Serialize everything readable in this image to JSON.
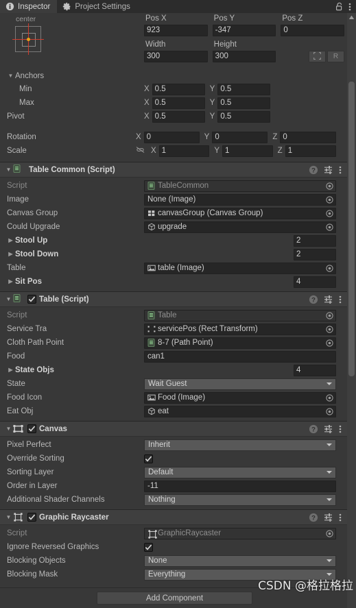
{
  "window": {
    "tabs": [
      {
        "label": "Inspector",
        "icon": "info-icon",
        "active": true
      },
      {
        "label": "Project Settings",
        "icon": "gear-icon",
        "active": false
      }
    ],
    "lock_icon": "lock-open-icon",
    "menu_icon": "kebab-menu-icon"
  },
  "rect_transform": {
    "anchor_preset": {
      "horizontal": "center",
      "vertical": "middle"
    },
    "fields": [
      {
        "label": "Pos X",
        "value": "923"
      },
      {
        "label": "Pos Y",
        "value": "-347"
      },
      {
        "label": "Pos Z",
        "value": "0"
      },
      {
        "label": "Width",
        "value": "300"
      },
      {
        "label": "Height",
        "value": "300"
      }
    ],
    "blueprint_button": "blueprint-mode-icon",
    "raw_button_label": "R",
    "anchors_label": "Anchors",
    "anchor_min": {
      "label": "Min",
      "x_label": "X",
      "x": "0.5",
      "y_label": "Y",
      "y": "0.5"
    },
    "anchor_max": {
      "label": "Max",
      "x_label": "X",
      "x": "0.5",
      "y_label": "Y",
      "y": "0.5"
    },
    "pivot": {
      "label": "Pivot",
      "x_label": "X",
      "x": "0.5",
      "y_label": "Y",
      "y": "0.5"
    },
    "rotation": {
      "label": "Rotation",
      "x_label": "X",
      "x": "0",
      "y_label": "Y",
      "y": "0",
      "z_label": "Z",
      "z": "0"
    },
    "scale": {
      "label": "Scale",
      "link_icon": "link-broken-icon",
      "x_label": "X",
      "x": "1",
      "y_label": "Y",
      "y": "1",
      "z_label": "Z",
      "z": "1"
    }
  },
  "components": [
    {
      "title": "Table Common (Script)",
      "icon": "cs-script-icon",
      "has_checkbox": false,
      "enabled": false,
      "rows": [
        {
          "kind": "object",
          "label": "Script",
          "label_dim": true,
          "value": "TableCommon",
          "icon": "cs-script-icon",
          "disabled": true
        },
        {
          "kind": "object",
          "label": "Image",
          "value": "None (Image)",
          "icon": "none-icon",
          "disabled": false
        },
        {
          "kind": "object",
          "label": "Canvas Group",
          "value": "canvasGroup (Canvas Group)",
          "icon": "canvas-group-icon",
          "disabled": false
        },
        {
          "kind": "object",
          "label": "Could Upgrade",
          "value": "upgrade",
          "icon": "prefab-cube-icon",
          "disabled": false
        },
        {
          "kind": "array",
          "label": "Stool Up",
          "value": "2"
        },
        {
          "kind": "array",
          "label": "Stool Down",
          "value": "2"
        },
        {
          "kind": "object",
          "label": "Table",
          "value": "table (Image)",
          "icon": "image-icon",
          "disabled": false
        },
        {
          "kind": "array",
          "label": "Sit Pos",
          "value": "4"
        }
      ]
    },
    {
      "title": "Table (Script)",
      "icon": "cs-script-icon",
      "has_checkbox": true,
      "enabled": true,
      "rows": [
        {
          "kind": "object",
          "label": "Script",
          "label_dim": true,
          "value": "Table",
          "icon": "cs-script-icon",
          "disabled": true
        },
        {
          "kind": "object",
          "label": "Service Tra",
          "value": "servicePos (Rect Transform)",
          "icon": "rect-transform-icon",
          "disabled": false
        },
        {
          "kind": "object",
          "label": "Cloth Path Point",
          "value": "8-7 (Path Point)",
          "icon": "cs-script-icon",
          "disabled": false
        },
        {
          "kind": "text",
          "label": "Food",
          "value": "can1"
        },
        {
          "kind": "array",
          "label": "State Objs",
          "value": "4"
        },
        {
          "kind": "dropdown",
          "label": "State",
          "value": "Wait Guest"
        },
        {
          "kind": "object",
          "label": "Food Icon",
          "value": "Food (Image)",
          "icon": "image-icon",
          "disabled": false
        },
        {
          "kind": "object",
          "label": "Eat Obj",
          "value": "eat",
          "icon": "prefab-cube-icon",
          "disabled": false
        }
      ]
    },
    {
      "title": "Canvas",
      "icon": "canvas-icon",
      "has_checkbox": true,
      "enabled": true,
      "rows": [
        {
          "kind": "dropdown",
          "label": "Pixel Perfect",
          "value": "Inherit"
        },
        {
          "kind": "checkbox",
          "label": "Override Sorting",
          "checked": true
        },
        {
          "kind": "dropdown",
          "label": "Sorting Layer",
          "value": "Default"
        },
        {
          "kind": "text",
          "label": "Order in Layer",
          "value": "-11"
        },
        {
          "kind": "dropdown",
          "label": "Additional Shader Channels",
          "value": "Nothing"
        }
      ]
    },
    {
      "title": "Graphic Raycaster",
      "icon": "graphic-raycaster-icon",
      "has_checkbox": true,
      "enabled": true,
      "rows": [
        {
          "kind": "object",
          "label": "Script",
          "label_dim": true,
          "value": "GraphicRaycaster",
          "icon": "graphic-raycaster-icon",
          "disabled": true
        },
        {
          "kind": "checkbox",
          "label": "Ignore Reversed Graphics",
          "checked": true
        },
        {
          "kind": "dropdown",
          "label": "Blocking Objects",
          "value": "None"
        },
        {
          "kind": "dropdown",
          "label": "Blocking Mask",
          "value": "Everything"
        }
      ]
    }
  ],
  "component_header_icons": {
    "help": "help-icon",
    "preset": "preset-icon",
    "menu": "kebab-menu-icon"
  },
  "footer": {
    "add_component_label": "Add Component",
    "watermark": "CSDN @格拉格拉"
  }
}
